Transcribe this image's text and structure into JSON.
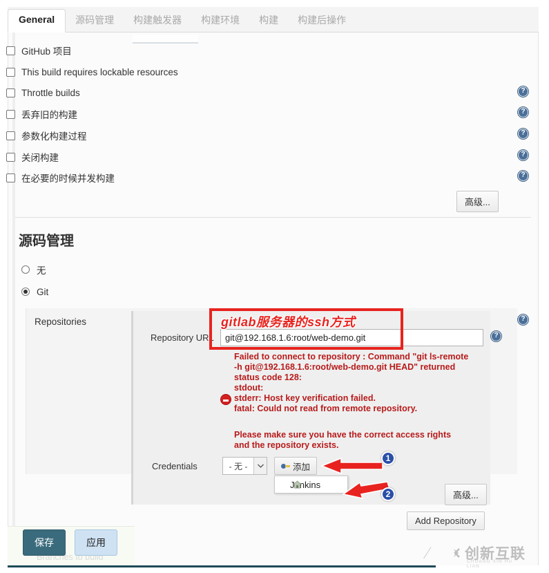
{
  "tabs": [
    {
      "label": "General",
      "active": true
    },
    {
      "label": "源码管理",
      "active": false
    },
    {
      "label": "构建触发器",
      "active": false
    },
    {
      "label": "构建环境",
      "active": false
    },
    {
      "label": "构建",
      "active": false
    },
    {
      "label": "构建后操作",
      "active": false
    }
  ],
  "general": {
    "checkboxes": [
      {
        "label": "GitHub 项目",
        "checked": false,
        "help": false
      },
      {
        "label": "This build requires lockable resources",
        "checked": false,
        "help": false
      },
      {
        "label": "Throttle builds",
        "checked": false,
        "help": true
      },
      {
        "label": "丢弃旧的构建",
        "checked": false,
        "help": true
      },
      {
        "label": "参数化构建过程",
        "checked": false,
        "help": true
      },
      {
        "label": "关闭构建",
        "checked": false,
        "help": true
      },
      {
        "label": "在必要的时候并发构建",
        "checked": false,
        "help": true
      }
    ],
    "advanced_label": "高级..."
  },
  "scm": {
    "section_title": "源码管理",
    "options": [
      {
        "label": "无",
        "selected": false
      },
      {
        "label": "Git",
        "selected": true
      }
    ],
    "repositories_label": "Repositories",
    "repository_url_label": "Repository URL",
    "repository_url_value": "git@192.168.1.6:root/web-demo.git",
    "credentials_label": "Credentials",
    "credentials_selected": "- 无 -",
    "add_button_label": "添加",
    "dropdown_items": [
      "Jenkins"
    ],
    "advanced_label": "高级...",
    "add_repository_label": "Add Repository",
    "ghost_branch_text": "Branches to build"
  },
  "annotation": {
    "callout_text": "gitlab服务器的ssh方式",
    "callout_color": "#e8231f",
    "badges": [
      {
        "number": "1"
      },
      {
        "number": "2"
      }
    ],
    "badge_color": "#2a4fa8",
    "arrow_color": "#e8231f"
  },
  "error": {
    "lines": [
      "Failed to connect to repository : Command \"git ls-remote",
      "-h git@192.168.1.6:root/web-demo.git HEAD\" returned",
      "status code 128:",
      "stdout:",
      "stderr: Host key verification failed.",
      "fatal: Could not read from remote repository."
    ],
    "lines2": [
      "Please make sure you have the correct access rights",
      "and the repository exists."
    ],
    "color": "#b81b1b"
  },
  "footer": {
    "save_label": "保存",
    "apply_label": "应用"
  },
  "watermark": {
    "main": "创新互联",
    "sub": "CHUANG XIN HU LIAN"
  },
  "icons": {
    "help": "?",
    "chevron_down": "▼"
  }
}
